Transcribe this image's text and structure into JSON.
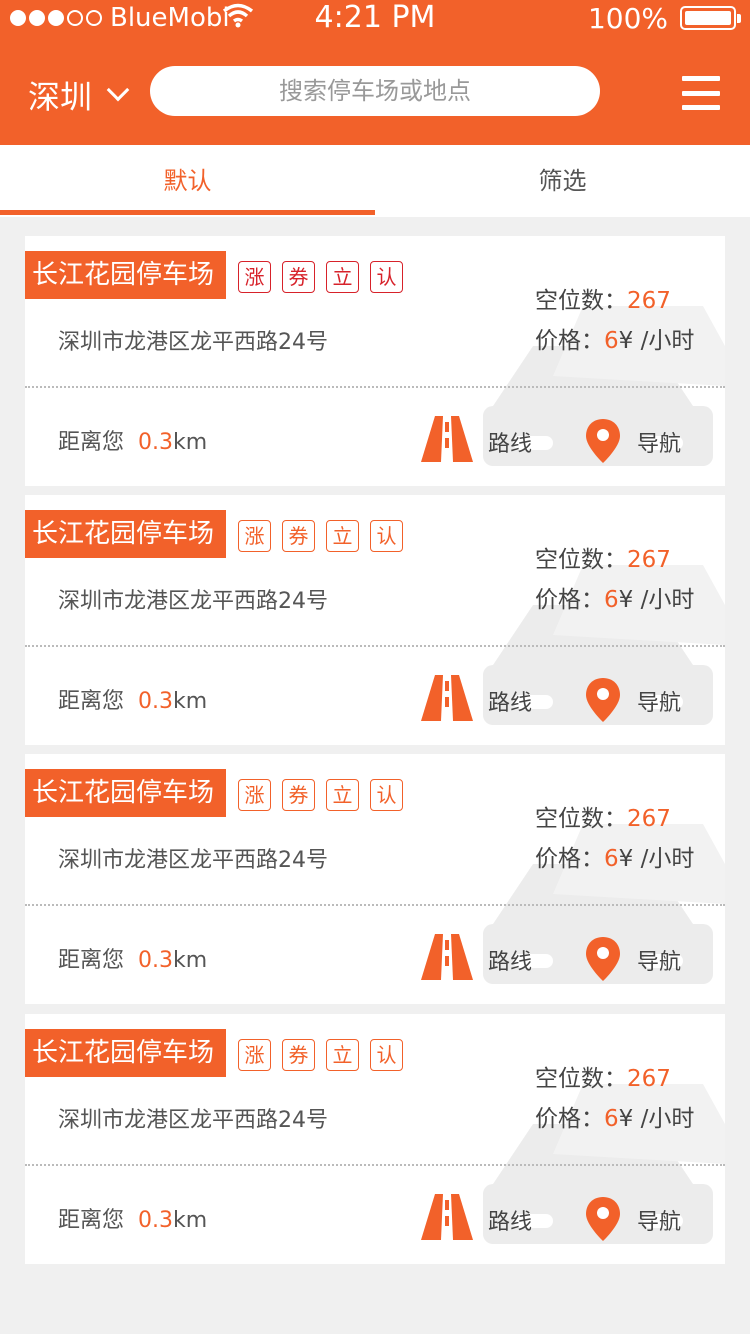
{
  "status_bar": {
    "carrier": "BlueMobi",
    "time": "4:21 PM",
    "battery": "100%"
  },
  "header": {
    "city": "深圳",
    "search_placeholder": "搜索停车场或地点"
  },
  "tabs": [
    {
      "label": "默认"
    },
    {
      "label": "筛选"
    }
  ],
  "colors": {
    "accent": "#f2612a",
    "tag_red": "#d7222a"
  },
  "cards": [
    {
      "name": "长江花园停车场",
      "tags": [
        "涨",
        "券",
        "立",
        "认"
      ],
      "address": "深圳市龙港区龙平西路24号",
      "spaces_label": "空位数：",
      "spaces": "267",
      "price_label": "价格：",
      "price": "6",
      "price_unit": "¥ /小时",
      "distance_label": "距离您",
      "distance_value": "0.3",
      "distance_unit": "km",
      "route_label": "路线",
      "nav_label": "导航"
    },
    {
      "name": "长江花园停车场",
      "tags": [
        "涨",
        "券",
        "立",
        "认"
      ],
      "address": "深圳市龙港区龙平西路24号",
      "spaces_label": "空位数：",
      "spaces": "267",
      "price_label": "价格：",
      "price": "6",
      "price_unit": "¥ /小时",
      "distance_label": "距离您",
      "distance_value": "0.3",
      "distance_unit": "km",
      "route_label": "路线",
      "nav_label": "导航"
    },
    {
      "name": "长江花园停车场",
      "tags": [
        "涨",
        "券",
        "立",
        "认"
      ],
      "address": "深圳市龙港区龙平西路24号",
      "spaces_label": "空位数：",
      "spaces": "267",
      "price_label": "价格：",
      "price": "6",
      "price_unit": "¥ /小时",
      "distance_label": "距离您",
      "distance_value": "0.3",
      "distance_unit": "km",
      "route_label": "路线",
      "nav_label": "导航"
    },
    {
      "name": "长江花园停车场",
      "tags": [
        "涨",
        "券",
        "立",
        "认"
      ],
      "address": "深圳市龙港区龙平西路24号",
      "spaces_label": "空位数：",
      "spaces": "267",
      "price_label": "价格：",
      "price": "6",
      "price_unit": "¥ /小时",
      "distance_label": "距离您",
      "distance_value": "0.3",
      "distance_unit": "km",
      "route_label": "路线",
      "nav_label": "导航"
    }
  ]
}
